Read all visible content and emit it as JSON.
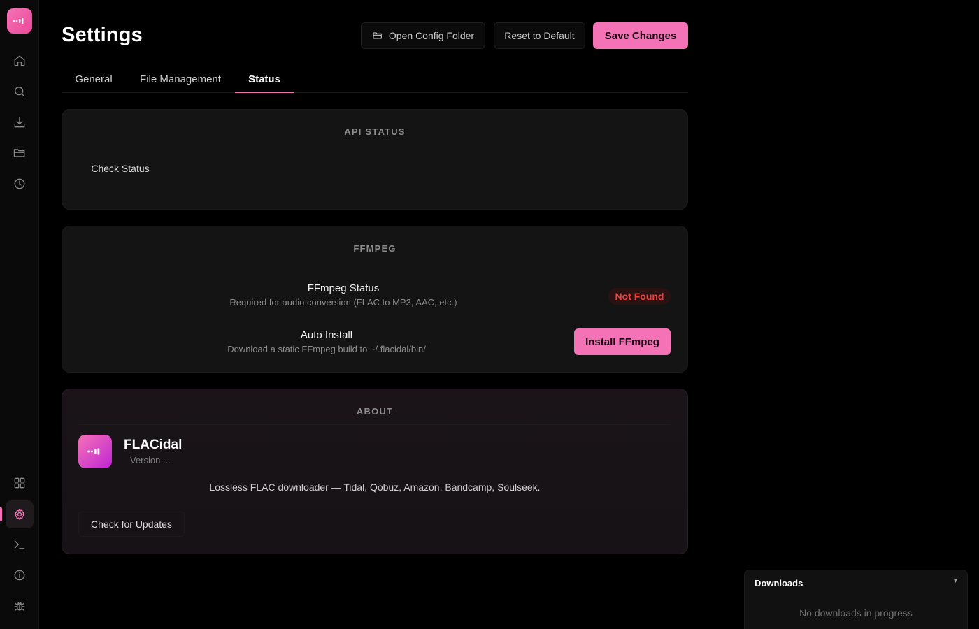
{
  "sidebar": {
    "logo_icon": "app-logo-icon",
    "items": [
      {
        "name": "home",
        "icon": "home-icon"
      },
      {
        "name": "search",
        "icon": "search-icon"
      },
      {
        "name": "download",
        "icon": "download-icon"
      },
      {
        "name": "folder",
        "icon": "folder-icon"
      },
      {
        "name": "history",
        "icon": "clock-icon"
      },
      {
        "name": "apps",
        "icon": "grid-icon"
      },
      {
        "name": "settings",
        "icon": "gear-icon",
        "active": true
      },
      {
        "name": "terminal",
        "icon": "terminal-icon"
      },
      {
        "name": "about",
        "icon": "info-icon"
      },
      {
        "name": "debug",
        "icon": "bug-icon"
      }
    ]
  },
  "header": {
    "title": "Settings",
    "open_config_label": "Open Config Folder",
    "reset_label": "Reset to Default",
    "save_label": "Save Changes"
  },
  "tabs": [
    {
      "label": "General",
      "active": false
    },
    {
      "label": "File Management",
      "active": false
    },
    {
      "label": "Status",
      "active": true
    }
  ],
  "api_status": {
    "heading": "API STATUS",
    "check_label": "Check Status"
  },
  "ffmpeg": {
    "heading": "FFMPEG",
    "status_title": "FFmpeg Status",
    "status_desc": "Required for audio conversion (FLAC to MP3, AAC, etc.)",
    "status_badge": "Not Found",
    "install_title": "Auto Install",
    "install_desc": "Download a static FFmpeg build to ~/.flacidal/bin/",
    "install_label": "Install FFmpeg"
  },
  "about": {
    "heading": "ABOUT",
    "app_name": "FLACidal",
    "version": "Version ...",
    "description": "Lossless FLAC downloader — Tidal, Qobuz, Amazon, Bandcamp, Soulseek.",
    "update_label": "Check for Updates"
  },
  "downloads": {
    "title": "Downloads",
    "chevron": "▾",
    "empty_text": "No downloads in progress"
  },
  "colors": {
    "accent": "#f472b6",
    "background": "#000000",
    "card": "#141414",
    "error": "#ef4444"
  }
}
